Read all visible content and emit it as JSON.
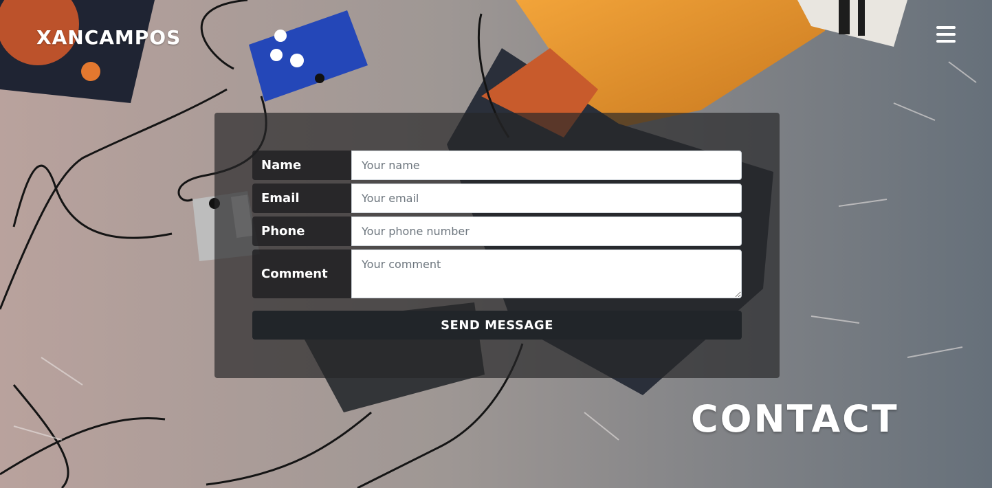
{
  "header": {
    "brand": "XANCAMPOS",
    "menu_icon": "hamburger-menu-icon"
  },
  "contact_form": {
    "fields": [
      {
        "label": "Name",
        "placeholder": "Your name"
      },
      {
        "label": "Email",
        "placeholder": "Your email"
      },
      {
        "label": "Phone",
        "placeholder": "Your phone number"
      },
      {
        "label": "Comment",
        "placeholder": "Your comment"
      }
    ],
    "submit_label": "SEND MESSAGE"
  },
  "page_heading": "CONTACT",
  "colors": {
    "panel_overlay": "#262628",
    "button_bg": "#212529",
    "text": "#ffffff"
  }
}
